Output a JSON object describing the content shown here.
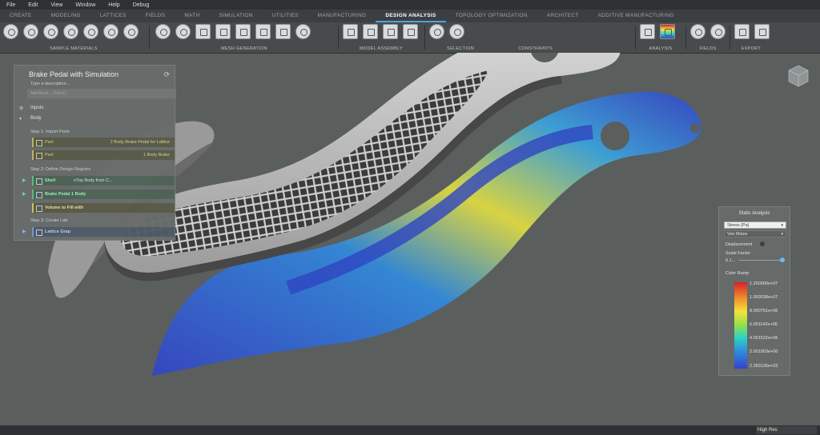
{
  "menubar": {
    "items": [
      "File",
      "Edit",
      "View",
      "Window",
      "Help",
      "Debug"
    ]
  },
  "tabs": [
    "CREATE",
    "MODELING",
    "LATTICES",
    "FIELDS",
    "MATH",
    "SIMULATION",
    "UTILITIES",
    "MANUFACTURING",
    "DESIGN ANALYSIS",
    "TOPOLOGY OPTIMIZATION",
    "ARCHITECT",
    "ADDITIVE MANUFACTURING"
  ],
  "active_tab": "DESIGN ANALYSIS",
  "ribbon": {
    "groups": [
      "SAMPLE MATERIALS",
      "MESH GENERATION",
      "MODEL ASSEMBLY",
      "SELECTION",
      "CONSTRAINTS",
      "ANALYSIS",
      "FIELDS",
      "EXPORT"
    ]
  },
  "notebook": {
    "title": "Brake Pedal with Simulation",
    "description_placeholder": "Type a description...",
    "add_block_placeholder": "Add Block... (Ctrl+L)",
    "inputs_label": "Inputs",
    "body_label": "Body",
    "step1": "Step 1: Import Parts",
    "part_label": "Part:",
    "part1_value": "2 Body Brake Pedal for Lattice",
    "part2_value": "1 Body Brake",
    "step2": "Step 2: Define Design Regions",
    "shell_label": "Shell",
    "shell_value": "nTop Body from C...",
    "brake_body_label": "Brake Pedal 1 Body",
    "volume_label": "Volume to Fill with",
    "step3": "Step 3: Create Latt",
    "lattice_label": "Lattice Grap"
  },
  "analysis_panel": {
    "title": "Static Analysis",
    "result_select": "Stress (Pa)",
    "component_select": "Von Mises",
    "displacement_label": "Displacement",
    "scale_factor_label": "Scale Factor",
    "scale_factor_value": "0.1...",
    "color_ramp_label": "Color Ramp",
    "ramp_ticks": [
      "1.200000e+07",
      "1.000038e+07",
      "8.000761e+06",
      "6.001142e+06",
      "4.001522e+06",
      "2.001903e+06",
      "2.283126e+03"
    ]
  },
  "statusbar": {
    "render_mode": "High Res"
  },
  "colors": {
    "accent": "#4aa3df",
    "background": "#5a5e5c"
  }
}
